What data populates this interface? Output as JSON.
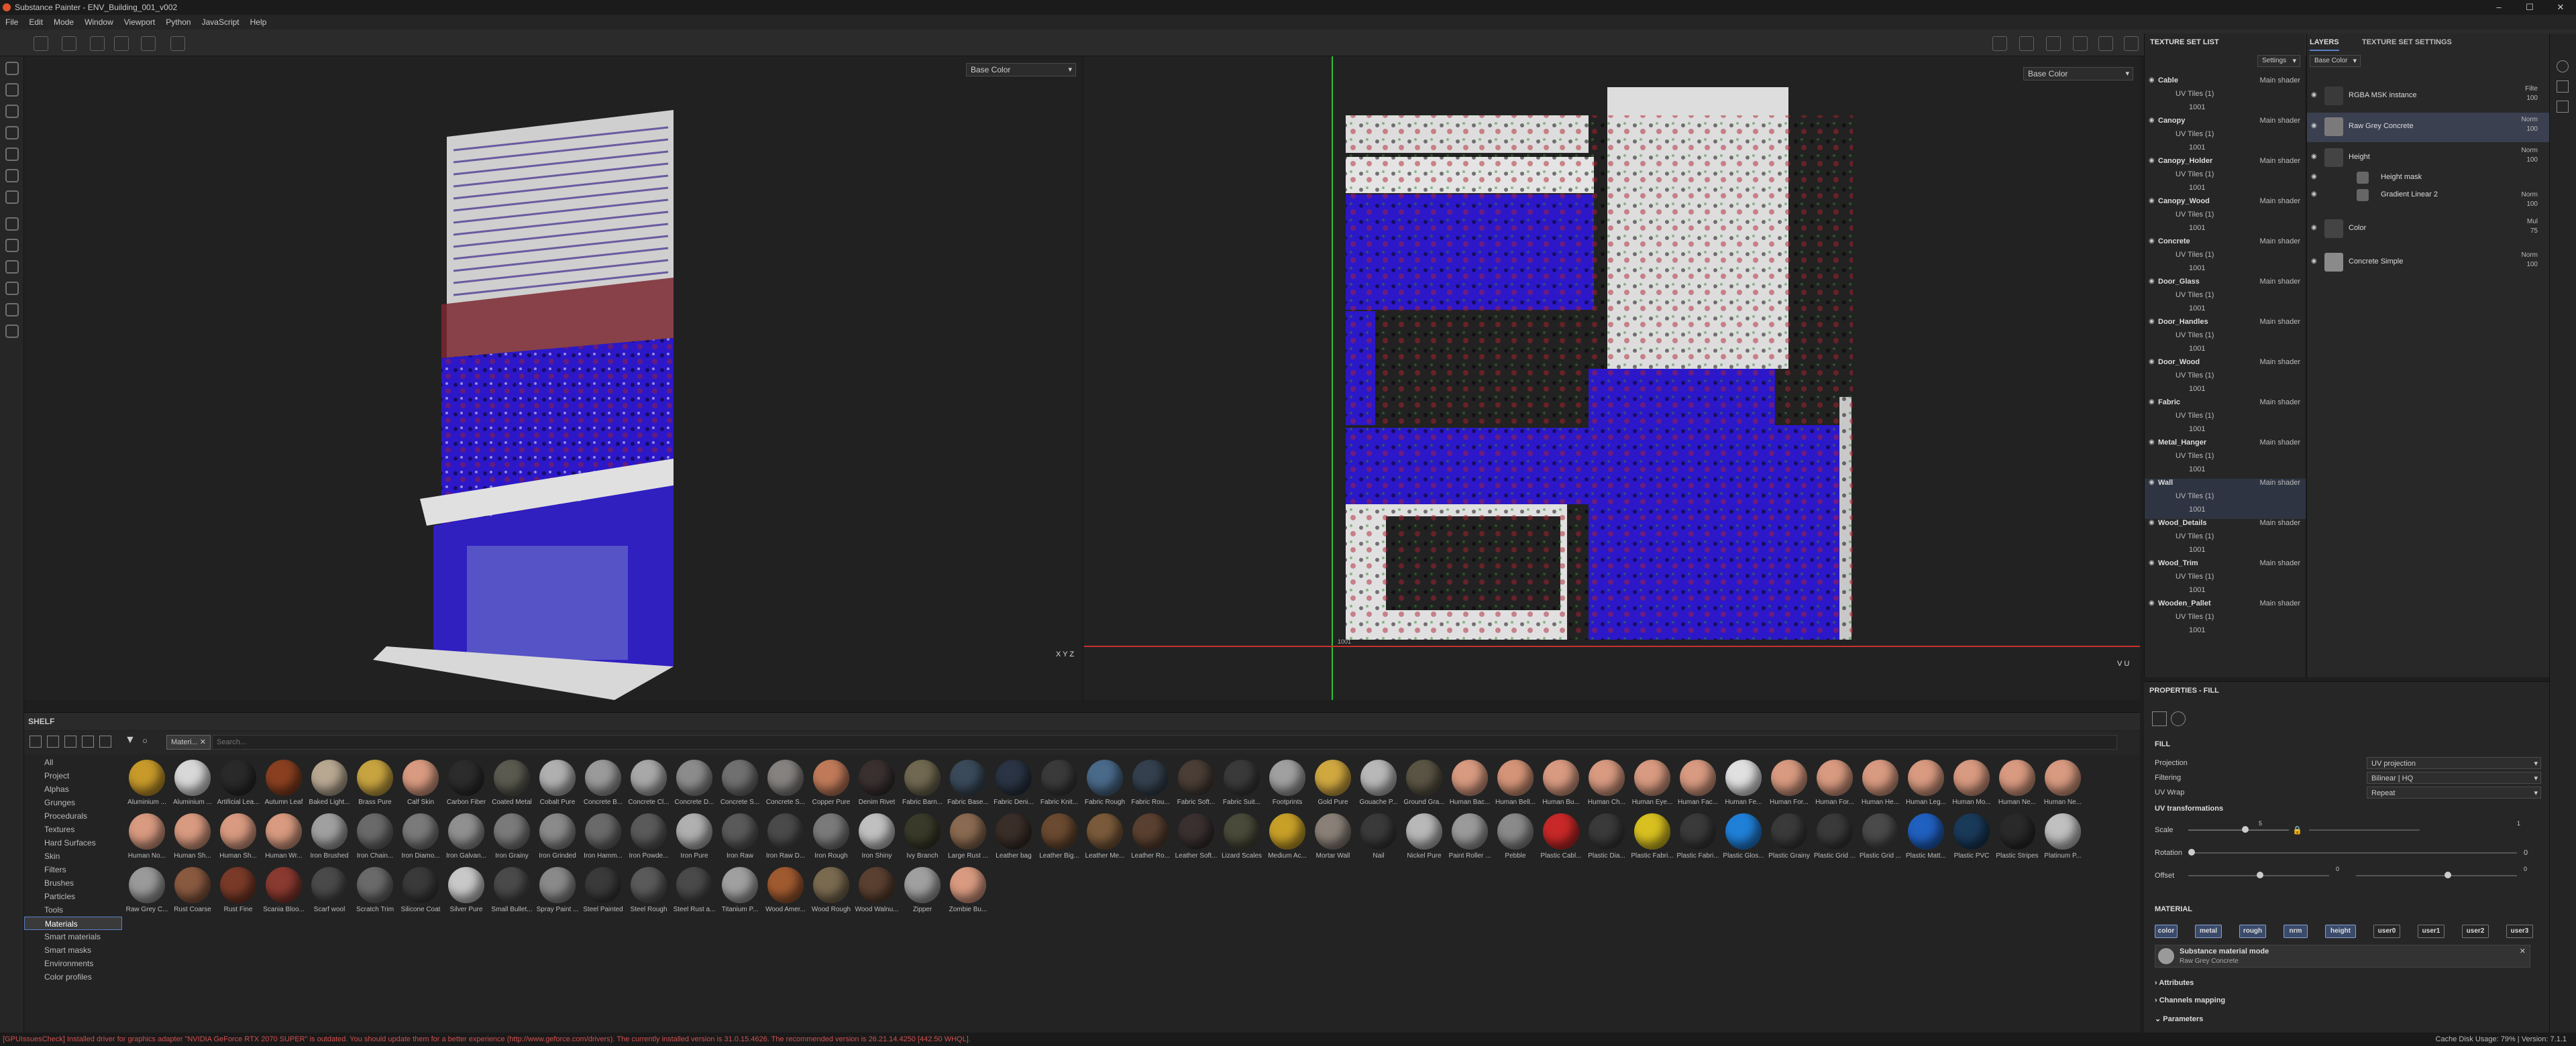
{
  "window": {
    "title": "Substance Painter - ENV_Building_001_v002"
  },
  "menu": [
    "File",
    "Edit",
    "Mode",
    "Window",
    "Viewport",
    "Python",
    "JavaScript",
    "Help"
  ],
  "viewport3d": {
    "channel": "Base Color",
    "axis_y": "Y",
    "axis_x": "X",
    "axis_z": "Z"
  },
  "viewportuv": {
    "channel": "Base Color",
    "axis_v": "V",
    "axis_u": "U",
    "tile_label": "1001"
  },
  "shelf": {
    "title": "SHELF",
    "filter_tag": "Materi...",
    "search_placeholder": "Search...",
    "categories": [
      "All",
      "Project",
      "Alphas",
      "Grunges",
      "Procedurals",
      "Textures",
      "Hard Surfaces",
      "Skin",
      "Filters",
      "Brushes",
      "Particles",
      "Tools",
      "Materials",
      "Smart materials",
      "Smart masks",
      "Environments",
      "Color profiles"
    ],
    "selected_category": "Materials",
    "materials": [
      {
        "name": "Aluminium ...",
        "color": "#c79a2a"
      },
      {
        "name": "Aluminium ...",
        "color": "#d8d8d8"
      },
      {
        "name": "Artificial Lea...",
        "color": "#2a2a2a"
      },
      {
        "name": "Autumn Leaf",
        "color": "#8a4020"
      },
      {
        "name": "Baked Light...",
        "color": "#b8a892"
      },
      {
        "name": "Brass Pure",
        "color": "#c8a440"
      },
      {
        "name": "Calf Skin",
        "color": "#d89a80"
      },
      {
        "name": "Carbon Fiber",
        "color": "#2c2c2c"
      },
      {
        "name": "Coated Metal",
        "color": "#5a5a50"
      },
      {
        "name": "Cobalt Pure",
        "color": "#b0b0b0"
      },
      {
        "name": "Concrete B...",
        "color": "#9a9a9a"
      },
      {
        "name": "Concrete Cl...",
        "color": "#a8a8a8"
      },
      {
        "name": "Concrete D...",
        "color": "#8c8c8c"
      },
      {
        "name": "Concrete S...",
        "color": "#707070"
      },
      {
        "name": "Concrete S...",
        "color": "#858280"
      },
      {
        "name": "Copper Pure",
        "color": "#c07a5a"
      },
      {
        "name": "Denim Rivet",
        "color": "#3a3030"
      },
      {
        "name": "Fabric Barn...",
        "color": "#706850"
      },
      {
        "name": "Fabric Base...",
        "color": "#3a4a5a"
      },
      {
        "name": "Fabric Deni...",
        "color": "#2a3444"
      },
      {
        "name": "Fabric Knit...",
        "color": "#3a3a3a"
      },
      {
        "name": "Fabric Rough",
        "color": "#4a6a8a"
      },
      {
        "name": "Fabric Rou...",
        "color": "#34404e"
      },
      {
        "name": "Fabric Soft...",
        "color": "#4a3e36"
      },
      {
        "name": "Fabric Suit...",
        "color": "#3a3a3a"
      },
      {
        "name": "Footprints",
        "color": "#a0a0a0"
      },
      {
        "name": "Gold Pure",
        "color": "#d0a840"
      },
      {
        "name": "Gouache P...",
        "color": "#b8b8b8"
      },
      {
        "name": "Ground Gra...",
        "color": "#5a5444"
      },
      {
        "name": "Human Bac...",
        "color": "#d89a80"
      },
      {
        "name": "Human Bell...",
        "color": "#d49478"
      },
      {
        "name": "Human Bu...",
        "color": "#d89a80"
      },
      {
        "name": "Human Ch...",
        "color": "#d89a80"
      },
      {
        "name": "Human Eye...",
        "color": "#d89a80"
      },
      {
        "name": "Human Fac...",
        "color": "#d89a80"
      },
      {
        "name": "Human Fe...",
        "color": "#e0e0e0"
      },
      {
        "name": "Human For...",
        "color": "#d89a80"
      },
      {
        "name": "Human For...",
        "color": "#d89a80"
      },
      {
        "name": "Human He...",
        "color": "#d89a80"
      },
      {
        "name": "Human Leg...",
        "color": "#d89a80"
      },
      {
        "name": "Human Mo...",
        "color": "#d89a80"
      },
      {
        "name": "Human Ne...",
        "color": "#d89a80"
      },
      {
        "name": "Human Ne...",
        "color": "#d89a80"
      },
      {
        "name": "Human No...",
        "color": "#d89a80"
      },
      {
        "name": "Human Sh...",
        "color": "#d89a80"
      },
      {
        "name": "Human Sh...",
        "color": "#d89a80"
      },
      {
        "name": "Human Wr...",
        "color": "#d89a80"
      },
      {
        "name": "Iron Brushed",
        "color": "#a0a0a0"
      },
      {
        "name": "Iron Chain...",
        "color": "#6a6a6a"
      },
      {
        "name": "Iron Diamo...",
        "color": "#7a7a7a"
      },
      {
        "name": "Iron Galvan...",
        "color": "#909090"
      },
      {
        "name": "Iron Grainy",
        "color": "#7a7a7a"
      },
      {
        "name": "Iron Grinded",
        "color": "#8a8a8a"
      },
      {
        "name": "Iron Hamm...",
        "color": "#6a6a6a"
      },
      {
        "name": "Iron Powde...",
        "color": "#5a5a5a"
      },
      {
        "name": "Iron Pure",
        "color": "#b0b0b0"
      },
      {
        "name": "Iron Raw",
        "color": "#5a5a5a"
      },
      {
        "name": "Iron Raw D...",
        "color": "#4a4a4a"
      },
      {
        "name": "Iron Rough",
        "color": "#7a7a7a"
      },
      {
        "name": "Iron Shiny",
        "color": "#c0c0c0"
      },
      {
        "name": "Ivy Branch",
        "color": "#3a3a2a"
      },
      {
        "name": "Large Rust ...",
        "color": "#8a6a50"
      },
      {
        "name": "Leather bag",
        "color": "#3a2e28"
      },
      {
        "name": "Leather Big...",
        "color": "#6a4a30"
      },
      {
        "name": "Leather Me...",
        "color": "#7a5a3a"
      },
      {
        "name": "Leather Ro...",
        "color": "#5a4030"
      },
      {
        "name": "Leather Soft...",
        "color": "#3a3030"
      },
      {
        "name": "Lizard Scales",
        "color": "#4a4a3a"
      },
      {
        "name": "Medium Ac...",
        "color": "#c8a028"
      },
      {
        "name": "Mortar Wall",
        "color": "#8a8078"
      },
      {
        "name": "Nail",
        "color": "#3a3a3a"
      },
      {
        "name": "Nickel Pure",
        "color": "#b8b8b8"
      },
      {
        "name": "Paint Roller ...",
        "color": "#9a9a9a"
      },
      {
        "name": "Pebble",
        "color": "#8a8a8a"
      },
      {
        "name": "Plastic Cabl...",
        "color": "#c82828"
      },
      {
        "name": "Plastic Dia...",
        "color": "#3a3a3a"
      },
      {
        "name": "Plastic Fabri...",
        "color": "#d8c020"
      },
      {
        "name": "Plastic Fabri...",
        "color": "#3a3a3a"
      },
      {
        "name": "Plastic Glos...",
        "color": "#2080d8"
      },
      {
        "name": "Plastic Grainy",
        "color": "#3a3a3a"
      },
      {
        "name": "Plastic Grid ...",
        "color": "#3a3a3a"
      },
      {
        "name": "Plastic Grid ...",
        "color": "#4a4a4a"
      },
      {
        "name": "Plastic Matt...",
        "color": "#2060c0"
      },
      {
        "name": "Plastic PVC",
        "color": "#1a3a5a"
      },
      {
        "name": "Plastic Stripes",
        "color": "#2a2a2a"
      },
      {
        "name": "Platinum P...",
        "color": "#c0c0c0"
      },
      {
        "name": "Raw Grey C...",
        "color": "#9a9a9a"
      },
      {
        "name": "Rust Coarse",
        "color": "#8a5a40"
      },
      {
        "name": "Rust Fine",
        "color": "#7a3a28"
      },
      {
        "name": "Scania Bloo...",
        "color": "#8a3a30"
      },
      {
        "name": "Scarf wool",
        "color": "#4a4a4a"
      },
      {
        "name": "Scratch Trim",
        "color": "#6a6a6a"
      },
      {
        "name": "Silicone Coat",
        "color": "#3a3a3a"
      },
      {
        "name": "Silver Pure",
        "color": "#c8c8c8"
      },
      {
        "name": "Small Bullet...",
        "color": "#4a4a4a"
      },
      {
        "name": "Spray Paint ...",
        "color": "#8a8a8a"
      },
      {
        "name": "Steel Painted",
        "color": "#3a3a3a"
      },
      {
        "name": "Steel Rough",
        "color": "#5a5a5a"
      },
      {
        "name": "Steel Rust a...",
        "color": "#4a4a4a"
      },
      {
        "name": "Titanium P...",
        "color": "#a0a0a0"
      },
      {
        "name": "Wood Amer...",
        "color": "#a05a30"
      },
      {
        "name": "Wood Rough",
        "color": "#7a6a50"
      },
      {
        "name": "Wood Walnu...",
        "color": "#5a4030"
      },
      {
        "name": "Zipper",
        "color": "#a0a0a0"
      },
      {
        "name": "Zombie Bu...",
        "color": "#d89a80"
      }
    ]
  },
  "texture_set_list": {
    "title": "TEXTURE SET LIST",
    "settings_label": "Settings",
    "sets": [
      {
        "name": "Cable",
        "shader": "Main shader",
        "uv": "UV Tiles (1)",
        "tile": "1001"
      },
      {
        "name": "Canopy",
        "shader": "Main shader",
        "uv": "UV Tiles (1)",
        "tile": "1001"
      },
      {
        "name": "Canopy_Holder",
        "shader": "Main shader",
        "uv": "UV Tiles (1)",
        "tile": "1001"
      },
      {
        "name": "Canopy_Wood",
        "shader": "Main shader",
        "uv": "UV Tiles (1)",
        "tile": "1001"
      },
      {
        "name": "Concrete",
        "shader": "Main shader",
        "uv": "UV Tiles (1)",
        "tile": "1001"
      },
      {
        "name": "Door_Glass",
        "shader": "Main shader",
        "uv": "UV Tiles (1)",
        "tile": "1001"
      },
      {
        "name": "Door_Handles",
        "shader": "Main shader",
        "uv": "UV Tiles (1)",
        "tile": "1001"
      },
      {
        "name": "Door_Wood",
        "shader": "Main shader",
        "uv": "UV Tiles (1)",
        "tile": "1001"
      },
      {
        "name": "Fabric",
        "shader": "Main shader",
        "uv": "UV Tiles (1)",
        "tile": "1001"
      },
      {
        "name": "Metal_Hanger",
        "shader": "Main shader",
        "uv": "UV Tiles (1)",
        "tile": "1001"
      },
      {
        "name": "Wall",
        "shader": "Main shader",
        "uv": "UV Tiles (1)",
        "tile": "1001"
      },
      {
        "name": "Wood_Details",
        "shader": "Main shader",
        "uv": "UV Tiles (1)",
        "tile": "1001"
      },
      {
        "name": "Wood_Trim",
        "shader": "Main shader",
        "uv": "UV Tiles (1)",
        "tile": "1001"
      },
      {
        "name": "Wooden_Pallet",
        "shader": "Main shader",
        "uv": "UV Tiles (1)",
        "tile": "1001"
      }
    ],
    "selected": "Wall"
  },
  "layers": {
    "tab_layers": "LAYERS",
    "tab_settings": "TEXTURE SET SETTINGS",
    "channel": "Base Color",
    "items": [
      {
        "name": "RGBA MSK instance",
        "blend": "Filte",
        "opacity": "100"
      },
      {
        "name": "Raw Grey Concrete",
        "blend": "Norm",
        "opacity": "100"
      },
      {
        "name": "Height",
        "blend": "Norm",
        "opacity": "100"
      },
      {
        "name": "Height mask",
        "blend": "",
        "opacity": ""
      },
      {
        "name": "Gradient Linear 2",
        "blend": "Norm",
        "opacity": "100"
      },
      {
        "name": "Color",
        "blend": "Mul",
        "opacity": "75"
      },
      {
        "name": "Concrete Simple",
        "blend": "Norm",
        "opacity": "100"
      }
    ]
  },
  "properties": {
    "title": "PROPERTIES - FILL",
    "section_fill": "FILL",
    "projection_label": "Projection",
    "projection_value": "UV projection",
    "filtering_label": "Filtering",
    "filtering_value": "Bilinear | HQ",
    "uvwrap_label": "UV Wrap",
    "uvwrap_value": "Repeat",
    "uvtrans_label": "UV transformations",
    "scale_label": "Scale",
    "scale_value": "5",
    "scale_max": "1",
    "rotation_label": "Rotation",
    "rotation_value": "0",
    "offset_label": "Offset",
    "offset_value": "0",
    "offset_value2": "0",
    "section_material": "MATERIAL",
    "channels": [
      "color",
      "metal",
      "rough",
      "nrm",
      "height",
      "user0",
      "user1",
      "user2",
      "user3"
    ],
    "channels_on": [
      "color",
      "metal",
      "rough",
      "nrm",
      "height"
    ],
    "material_mode_label": "Substance material mode",
    "material_mode_value": "Raw Grey Concrete",
    "attributes_label": "Attributes",
    "channels_mapping_label": "Channels mapping",
    "parameters_label": "Parameters"
  },
  "status": {
    "warning": "[GPUIssuesCheck] Installed driver for graphics adapter \"NVIDIA GeForce RTX 2070 SUPER\" is outdated. You should update them for a better experience (http://www.geforce.com/drivers). The currently installed version is 31.0.15.4626. The recommended version is 26.21.14.4250 [442.50 WHQL].",
    "cache": "Cache Disk Usage:   79% | Version: 7.1.1"
  },
  "colors": {
    "accent": "#5a80c8",
    "warning": "#d05050"
  }
}
